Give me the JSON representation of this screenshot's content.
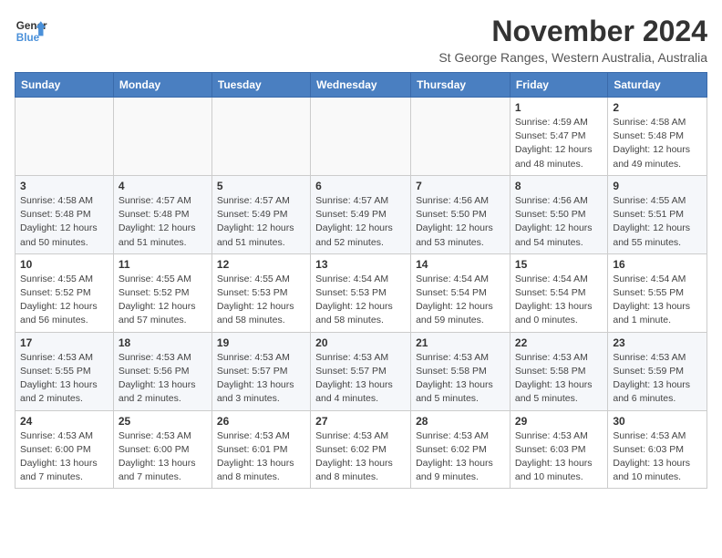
{
  "logo": {
    "line1": "General",
    "line2": "Blue"
  },
  "title": "November 2024",
  "location": "St George Ranges, Western Australia, Australia",
  "days_of_week": [
    "Sunday",
    "Monday",
    "Tuesday",
    "Wednesday",
    "Thursday",
    "Friday",
    "Saturday"
  ],
  "weeks": [
    [
      {
        "day": "",
        "info": ""
      },
      {
        "day": "",
        "info": ""
      },
      {
        "day": "",
        "info": ""
      },
      {
        "day": "",
        "info": ""
      },
      {
        "day": "",
        "info": ""
      },
      {
        "day": "1",
        "info": "Sunrise: 4:59 AM\nSunset: 5:47 PM\nDaylight: 12 hours\nand 48 minutes."
      },
      {
        "day": "2",
        "info": "Sunrise: 4:58 AM\nSunset: 5:48 PM\nDaylight: 12 hours\nand 49 minutes."
      }
    ],
    [
      {
        "day": "3",
        "info": "Sunrise: 4:58 AM\nSunset: 5:48 PM\nDaylight: 12 hours\nand 50 minutes."
      },
      {
        "day": "4",
        "info": "Sunrise: 4:57 AM\nSunset: 5:48 PM\nDaylight: 12 hours\nand 51 minutes."
      },
      {
        "day": "5",
        "info": "Sunrise: 4:57 AM\nSunset: 5:49 PM\nDaylight: 12 hours\nand 51 minutes."
      },
      {
        "day": "6",
        "info": "Sunrise: 4:57 AM\nSunset: 5:49 PM\nDaylight: 12 hours\nand 52 minutes."
      },
      {
        "day": "7",
        "info": "Sunrise: 4:56 AM\nSunset: 5:50 PM\nDaylight: 12 hours\nand 53 minutes."
      },
      {
        "day": "8",
        "info": "Sunrise: 4:56 AM\nSunset: 5:50 PM\nDaylight: 12 hours\nand 54 minutes."
      },
      {
        "day": "9",
        "info": "Sunrise: 4:55 AM\nSunset: 5:51 PM\nDaylight: 12 hours\nand 55 minutes."
      }
    ],
    [
      {
        "day": "10",
        "info": "Sunrise: 4:55 AM\nSunset: 5:52 PM\nDaylight: 12 hours\nand 56 minutes."
      },
      {
        "day": "11",
        "info": "Sunrise: 4:55 AM\nSunset: 5:52 PM\nDaylight: 12 hours\nand 57 minutes."
      },
      {
        "day": "12",
        "info": "Sunrise: 4:55 AM\nSunset: 5:53 PM\nDaylight: 12 hours\nand 58 minutes."
      },
      {
        "day": "13",
        "info": "Sunrise: 4:54 AM\nSunset: 5:53 PM\nDaylight: 12 hours\nand 58 minutes."
      },
      {
        "day": "14",
        "info": "Sunrise: 4:54 AM\nSunset: 5:54 PM\nDaylight: 12 hours\nand 59 minutes."
      },
      {
        "day": "15",
        "info": "Sunrise: 4:54 AM\nSunset: 5:54 PM\nDaylight: 13 hours\nand 0 minutes."
      },
      {
        "day": "16",
        "info": "Sunrise: 4:54 AM\nSunset: 5:55 PM\nDaylight: 13 hours\nand 1 minute."
      }
    ],
    [
      {
        "day": "17",
        "info": "Sunrise: 4:53 AM\nSunset: 5:55 PM\nDaylight: 13 hours\nand 2 minutes."
      },
      {
        "day": "18",
        "info": "Sunrise: 4:53 AM\nSunset: 5:56 PM\nDaylight: 13 hours\nand 2 minutes."
      },
      {
        "day": "19",
        "info": "Sunrise: 4:53 AM\nSunset: 5:57 PM\nDaylight: 13 hours\nand 3 minutes."
      },
      {
        "day": "20",
        "info": "Sunrise: 4:53 AM\nSunset: 5:57 PM\nDaylight: 13 hours\nand 4 minutes."
      },
      {
        "day": "21",
        "info": "Sunrise: 4:53 AM\nSunset: 5:58 PM\nDaylight: 13 hours\nand 5 minutes."
      },
      {
        "day": "22",
        "info": "Sunrise: 4:53 AM\nSunset: 5:58 PM\nDaylight: 13 hours\nand 5 minutes."
      },
      {
        "day": "23",
        "info": "Sunrise: 4:53 AM\nSunset: 5:59 PM\nDaylight: 13 hours\nand 6 minutes."
      }
    ],
    [
      {
        "day": "24",
        "info": "Sunrise: 4:53 AM\nSunset: 6:00 PM\nDaylight: 13 hours\nand 7 minutes."
      },
      {
        "day": "25",
        "info": "Sunrise: 4:53 AM\nSunset: 6:00 PM\nDaylight: 13 hours\nand 7 minutes."
      },
      {
        "day": "26",
        "info": "Sunrise: 4:53 AM\nSunset: 6:01 PM\nDaylight: 13 hours\nand 8 minutes."
      },
      {
        "day": "27",
        "info": "Sunrise: 4:53 AM\nSunset: 6:02 PM\nDaylight: 13 hours\nand 8 minutes."
      },
      {
        "day": "28",
        "info": "Sunrise: 4:53 AM\nSunset: 6:02 PM\nDaylight: 13 hours\nand 9 minutes."
      },
      {
        "day": "29",
        "info": "Sunrise: 4:53 AM\nSunset: 6:03 PM\nDaylight: 13 hours\nand 10 minutes."
      },
      {
        "day": "30",
        "info": "Sunrise: 4:53 AM\nSunset: 6:03 PM\nDaylight: 13 hours\nand 10 minutes."
      }
    ]
  ]
}
